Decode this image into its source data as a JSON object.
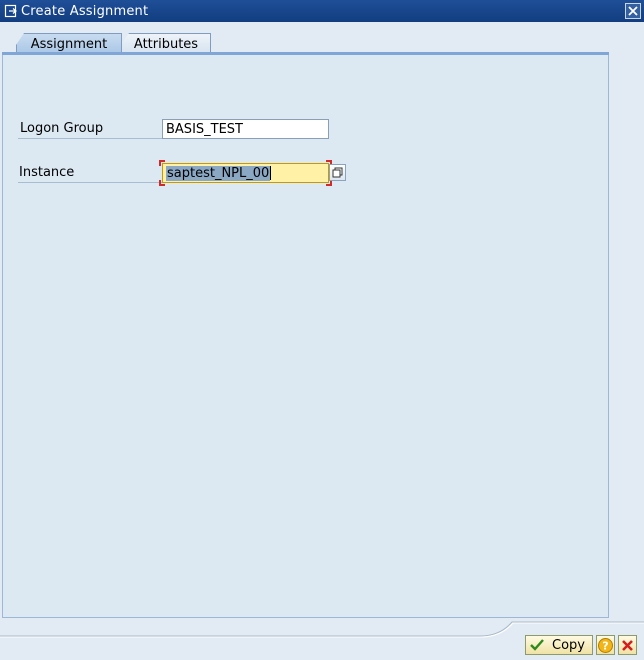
{
  "window": {
    "title": "Create Assignment",
    "window_icon": "new-window-icon",
    "close_icon": "close-icon"
  },
  "tabs": [
    {
      "label": "Assignment",
      "active": true
    },
    {
      "label": "Attributes",
      "active": false
    }
  ],
  "form": {
    "logon_group": {
      "label": "Logon Group",
      "value": "BASIS_TEST"
    },
    "instance": {
      "label": "Instance",
      "value": "saptest_NPL_00",
      "selected": true,
      "value_help_icon": "value-help-icon"
    }
  },
  "footer": {
    "copy_label": "Copy",
    "copy_icon": "checkmark-icon",
    "help_icon": "help-icon",
    "cancel_icon": "cancel-icon"
  },
  "colors": {
    "title_bar": "#1f4f98",
    "panel": "#dce8f2",
    "active_field": "#fff1a6",
    "button_face": "#f0e2a4"
  }
}
